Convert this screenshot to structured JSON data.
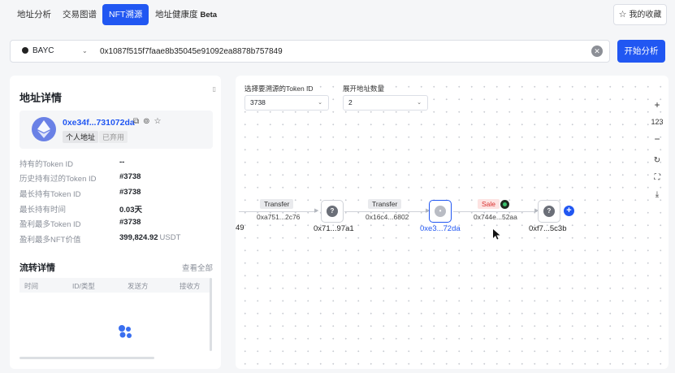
{
  "tabs": [
    {
      "label": "地址分析"
    },
    {
      "label": "交易图谱"
    },
    {
      "label": "NFT溯源",
      "active": true
    },
    {
      "label": "地址健康度",
      "badge": "Beta"
    }
  ],
  "favorites_label": "我的收藏",
  "search": {
    "collection": "BAYC",
    "address": "0x1087f515f7faae8b35045e91092ea8878b757849",
    "start_label": "开始分析"
  },
  "details": {
    "title": "地址详情",
    "address_short": "0xe34f...731072da",
    "tag_type": "个人地址",
    "tag_status": "已弃用",
    "rows": [
      {
        "label": "持有的Token ID",
        "value": "--"
      },
      {
        "label": "历史持有过的Token ID",
        "value": "#3738"
      },
      {
        "label": "最长持有Token ID",
        "value": "#3738"
      },
      {
        "label": "最长持有时间",
        "value": "0.03天"
      },
      {
        "label": "盈利最多Token ID",
        "value": "#3738"
      },
      {
        "label": "盈利最多NFT价值",
        "value": "399,824.92",
        "unit": "USDT"
      }
    ]
  },
  "flow": {
    "title": "流转详情",
    "view_all": "查看全部",
    "columns": [
      "时间",
      "ID/类型",
      "发送方",
      "接收方"
    ]
  },
  "canvas": {
    "token_select_label": "选择要溯源的Token ID",
    "token_value": "3738",
    "expand_label": "展开地址数量",
    "expand_value": "2",
    "zoom_level": "123",
    "partial_label": "49",
    "nodes": [
      {
        "label": "0x71...97a1"
      },
      {
        "label": "0x16c4...6802"
      },
      {
        "label": "0xe3...72da"
      },
      {
        "label": "0xf7...5c3b"
      }
    ],
    "edges": [
      {
        "type": "Transfer",
        "hash": "0xa751...2c76"
      },
      {
        "type": "Transfer",
        "hash": "0x16c4...6802"
      },
      {
        "type": "Sale",
        "hash": "0x744e...52aa"
      }
    ]
  }
}
